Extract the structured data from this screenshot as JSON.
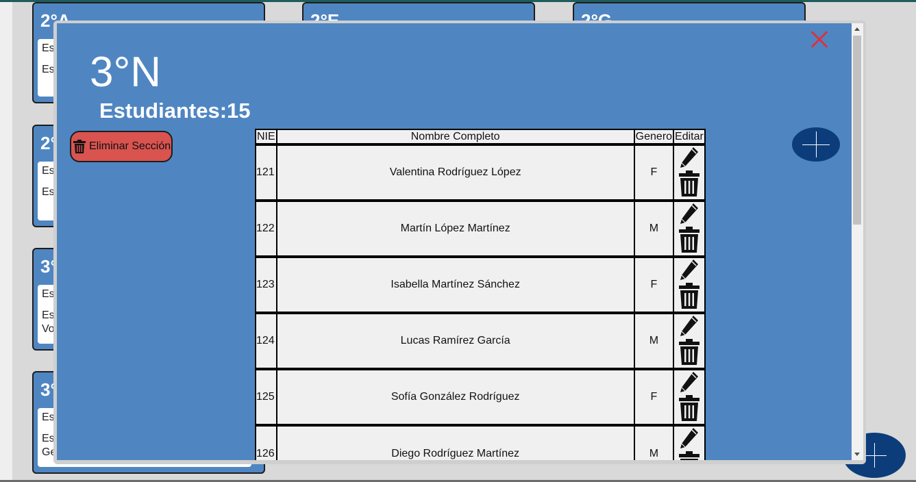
{
  "background_cards": [
    {
      "title": "2°A",
      "lines": [
        "Es",
        "Es"
      ]
    },
    {
      "title": "2°E",
      "lines": []
    },
    {
      "title": "2°G",
      "lines": []
    },
    {
      "title": "2°",
      "lines": [
        "Es",
        "Es"
      ]
    },
    {
      "title": "3°",
      "lines": [
        "Es",
        "Es",
        "Vo"
      ]
    },
    {
      "title": "3°",
      "lines": [
        "Es",
        "Es",
        "Ge"
      ]
    }
  ],
  "modal": {
    "section_title": "3°N",
    "students_label": "Estudiantes:",
    "students_count": "15",
    "delete_section_label": "Eliminar Sección",
    "table": {
      "headers": [
        "NIE",
        "Nombre Completo",
        "Genero",
        "Editar"
      ],
      "rows": [
        {
          "nie": "121",
          "name": "Valentina Rodríguez López",
          "gender": "F"
        },
        {
          "nie": "122",
          "name": "Martín López Martínez",
          "gender": "M"
        },
        {
          "nie": "123",
          "name": "Isabella Martínez Sánchez",
          "gender": "F"
        },
        {
          "nie": "124",
          "name": "Lucas Ramírez García",
          "gender": "M"
        },
        {
          "nie": "125",
          "name": "Sofía González Rodríguez",
          "gender": "F"
        },
        {
          "nie": "126",
          "name": "Diego Rodríguez Martínez",
          "gender": "M"
        }
      ]
    }
  },
  "icons": {
    "close": "close-icon",
    "trash": "trash-icon",
    "edit": "pencil-icon",
    "add": "plus-icon"
  },
  "colors": {
    "panel": "#4f86c2",
    "danger": "#d9534f",
    "close": "#d8333f",
    "fab": "#0c3d7a"
  }
}
